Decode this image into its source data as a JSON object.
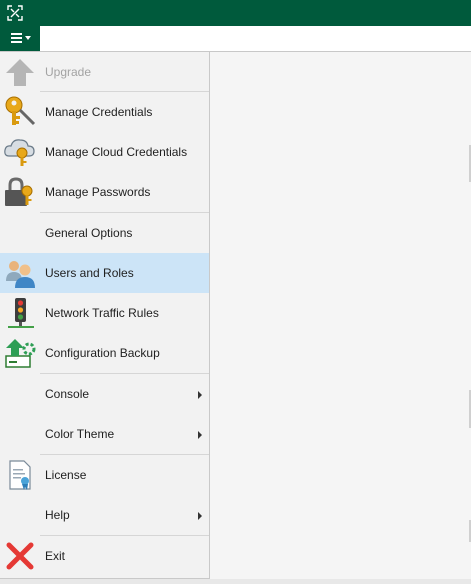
{
  "window": {
    "app_icon": "veeam-logo-icon",
    "titlebar_color": "#005a3c",
    "menu_button_icon": "hamburger-menu-icon"
  },
  "menu": {
    "items": [
      {
        "label": "Upgrade",
        "icon": "upgrade-arrow-icon",
        "disabled": true
      },
      {
        "label": "Manage Credentials",
        "icon": "credentials-key-icon"
      },
      {
        "label": "Manage Cloud Credentials",
        "icon": "cloud-key-icon"
      },
      {
        "label": "Manage Passwords",
        "icon": "lock-key-icon"
      },
      {
        "label": "General Options"
      },
      {
        "label": "Users and Roles",
        "icon": "users-icon",
        "selected": true
      },
      {
        "label": "Network Traffic Rules",
        "icon": "traffic-light-icon"
      },
      {
        "label": "Configuration Backup",
        "icon": "config-backup-icon"
      },
      {
        "label": "Console",
        "submenu": true
      },
      {
        "label": "Color Theme",
        "submenu": true
      },
      {
        "label": "License",
        "icon": "license-certificate-icon"
      },
      {
        "label": "Help",
        "submenu": true
      },
      {
        "label": "Exit",
        "icon": "exit-x-icon"
      }
    ],
    "selected_color": "#cce4f7"
  }
}
